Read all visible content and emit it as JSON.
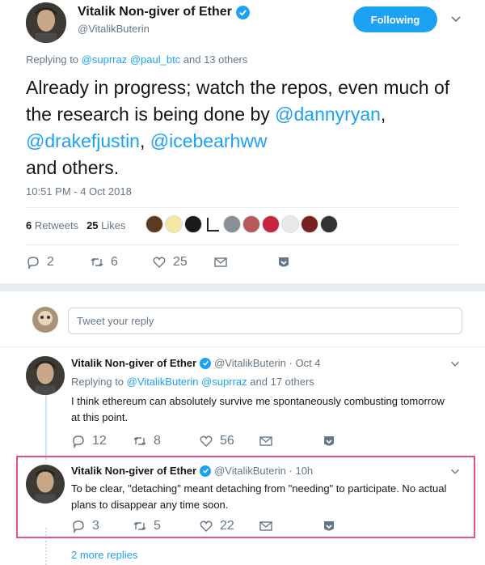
{
  "main_tweet": {
    "author_name": "Vitalik Non-giver of Ether",
    "handle": "@VitalikButerin",
    "follow_label": "Following",
    "replying_prefix": "Replying to",
    "replying_mentions": "@suprraz @paul_btc",
    "replying_suffix": "and 13 others",
    "text_part1": "Already in progress; watch the repos, even much of the research is being done by",
    "mention1": "@dannyryan",
    "comma1": ",",
    "mention2": "@drakefjustin",
    "comma2": ",",
    "mention3": "@icebearhww",
    "text_part2": "and others.",
    "timestamp": "10:51 PM - 4 Oct 2018",
    "retweets_count": "6",
    "retweets_label": "Retweets",
    "likes_count": "25",
    "likes_label": "Likes",
    "reply_count": "2",
    "retweet_count": "6",
    "like_count": "25"
  },
  "compose": {
    "placeholder": "Tweet your reply"
  },
  "replies": [
    {
      "author_name": "Vitalik Non-giver of Ether",
      "handle_time": "@VitalikButerin · Oct 4",
      "replying_prefix": "Replying to",
      "replying_mentions": "@VitalikButerin @suprraz",
      "replying_suffix": "and 17 others",
      "text": "I think ethereum can absolutely survive me spontaneously combusting tomorrow at this point.",
      "reply_count": "12",
      "retweet_count": "8",
      "like_count": "56"
    },
    {
      "author_name": "Vitalik Non-giver of Ether",
      "handle_time": "@VitalikButerin · 10h",
      "text": "To be clear, \"detaching\" meant detaching from \"needing\" to participate. No actual plans to disappear any time soon.",
      "reply_count": "3",
      "retweet_count": "5",
      "like_count": "22"
    }
  ],
  "more_replies": "2 more replies",
  "colors": {
    "accent": "#1da1f2",
    "highlight": "#e0528c",
    "secondary_text": "#657786"
  }
}
